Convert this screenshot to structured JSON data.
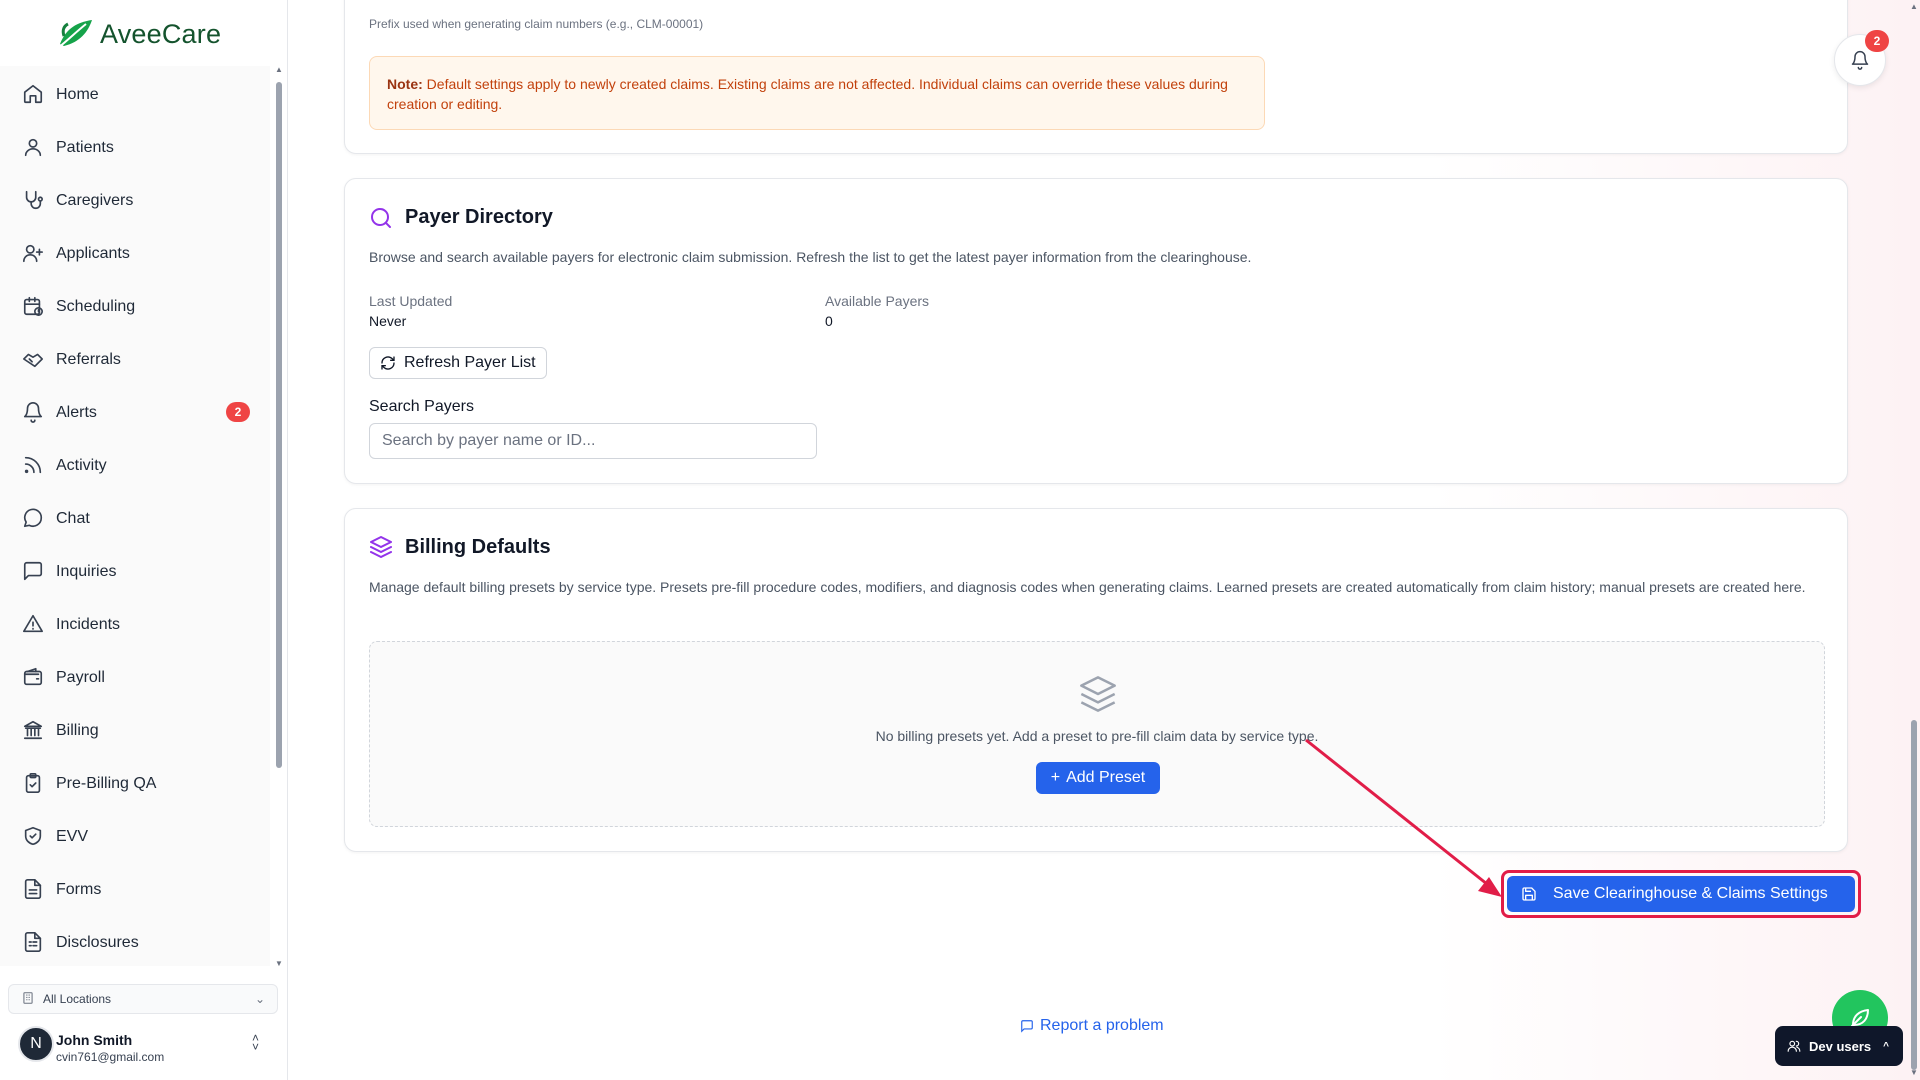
{
  "app": {
    "name": "AveeCare"
  },
  "sidebar": {
    "items": [
      {
        "label": "Home",
        "icon": "home-icon"
      },
      {
        "label": "Patients",
        "icon": "user-icon"
      },
      {
        "label": "Caregivers",
        "icon": "stethoscope-icon"
      },
      {
        "label": "Applicants",
        "icon": "user-plus-icon"
      },
      {
        "label": "Scheduling",
        "icon": "calendar-clock-icon"
      },
      {
        "label": "Referrals",
        "icon": "handshake-icon"
      },
      {
        "label": "Alerts",
        "icon": "bell-icon",
        "badge": "2"
      },
      {
        "label": "Activity",
        "icon": "rss-icon"
      },
      {
        "label": "Chat",
        "icon": "message-circle-icon"
      },
      {
        "label": "Inquiries",
        "icon": "message-square-icon"
      },
      {
        "label": "Incidents",
        "icon": "alert-triangle-icon"
      },
      {
        "label": "Payroll",
        "icon": "wallet-icon"
      },
      {
        "label": "Billing",
        "icon": "landmark-icon"
      },
      {
        "label": "Pre-Billing QA",
        "icon": "clipboard-check-icon"
      },
      {
        "label": "EVV",
        "icon": "shield-check-icon"
      },
      {
        "label": "Forms",
        "icon": "file-text-icon"
      },
      {
        "label": "Disclosures",
        "icon": "file-list-icon"
      }
    ],
    "location_select": "All Locations",
    "user": {
      "initial": "N",
      "name": "John Smith",
      "email": "cvin761@gmail.com"
    }
  },
  "claims_top": {
    "prefix_help": "Prefix used when generating claim numbers (e.g., CLM-00001)",
    "note_label": "Note:",
    "note_text": "Default settings apply to newly created claims. Existing claims are not affected. Individual claims can override these values during creation or editing."
  },
  "payer_directory": {
    "title": "Payer Directory",
    "description": "Browse and search available payers for electronic claim submission. Refresh the list to get the latest payer information from the clearinghouse.",
    "last_updated_label": "Last Updated",
    "last_updated_value": "Never",
    "available_payers_label": "Available Payers",
    "available_payers_value": "0",
    "refresh_button": "Refresh Payer List",
    "search_label": "Search Payers",
    "search_placeholder": "Search by payer name or ID..."
  },
  "billing_defaults": {
    "title": "Billing Defaults",
    "description": "Manage default billing presets by service type. Presets pre-fill procedure codes, modifiers, and diagnosis codes when generating claims. Learned presets are created automatically from claim history; manual presets are created here.",
    "empty_text": "No billing presets yet. Add a preset to pre-fill claim data by service type.",
    "add_button": "Add Preset"
  },
  "actions": {
    "save_button": "Save Clearinghouse & Claims Settings",
    "report_link": "Report a problem"
  },
  "header": {
    "notification_count": "2"
  },
  "dev_users": {
    "label": "Dev users"
  },
  "colors": {
    "primary": "#2563eb",
    "accent_purple": "#9333ea",
    "note_bg": "#fff7ed",
    "note_text": "#c2410c",
    "badge_red": "#ef4444",
    "highlight": "#e11d48",
    "brand_green": "#22c55e"
  }
}
